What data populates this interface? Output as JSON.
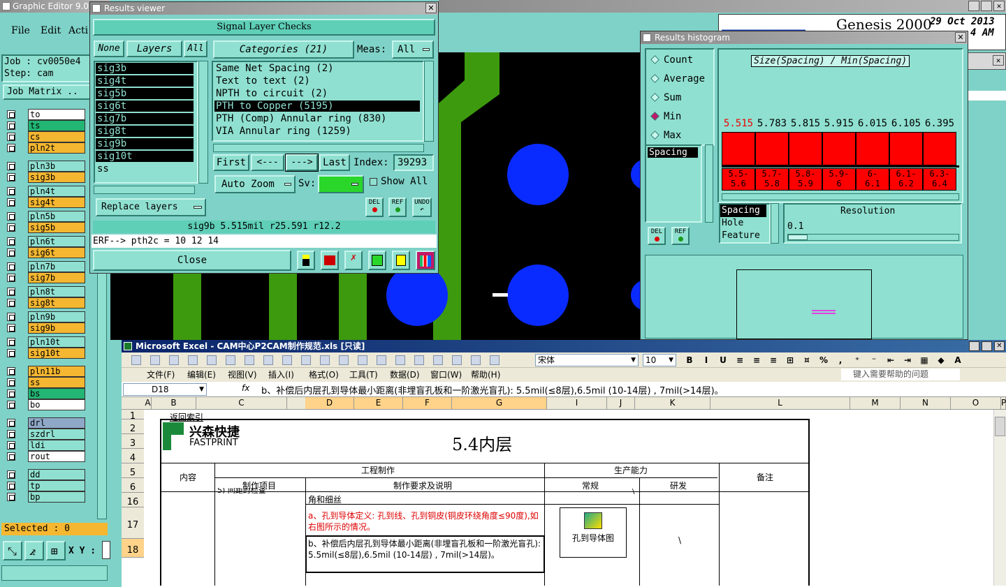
{
  "graphic_editor": {
    "title": "Graphic Editor 9.02",
    "menu": [
      "File",
      "Edit",
      "Acti"
    ],
    "job": "Job : cv0050e4",
    "step": "Step: cam",
    "job_matrix": "Job Matrix ..",
    "selected": "Selected : 0",
    "xy_label": "X Y :"
  },
  "layers_left": [
    {
      "name": "to",
      "color": "#ffffff"
    },
    {
      "name": "ts",
      "color": "#22b573"
    },
    {
      "name": "cs",
      "color": "#f5b731"
    },
    {
      "name": "pln2t",
      "color": "#f5b731"
    },
    {
      "name": "pln3b",
      "color": "#8fe0d0"
    },
    {
      "name": "sig3b",
      "color": "#f5b731"
    },
    {
      "name": "pln4t",
      "color": "#8fe0d0"
    },
    {
      "name": "sig4t",
      "color": "#f5b731"
    },
    {
      "name": "pln5b",
      "color": "#8fe0d0"
    },
    {
      "name": "sig5b",
      "color": "#f5b731"
    },
    {
      "name": "pln6t",
      "color": "#8fe0d0"
    },
    {
      "name": "sig6t",
      "color": "#f5b731"
    },
    {
      "name": "pln7b",
      "color": "#8fe0d0"
    },
    {
      "name": "sig7b",
      "color": "#f5b731"
    },
    {
      "name": "pln8t",
      "color": "#8fe0d0"
    },
    {
      "name": "sig8t",
      "color": "#f5b731"
    },
    {
      "name": "pln9b",
      "color": "#8fe0d0"
    },
    {
      "name": "sig9b",
      "color": "#f5b731"
    },
    {
      "name": "pln10t",
      "color": "#8fe0d0"
    },
    {
      "name": "sig10t",
      "color": "#f5b731"
    },
    {
      "name": "pln11b",
      "color": "#f5b731"
    },
    {
      "name": "ss",
      "color": "#f5b731"
    },
    {
      "name": "bs",
      "color": "#22b573"
    },
    {
      "name": "bo",
      "color": "#ffffff"
    },
    {
      "name": "drl",
      "color": "#8fa8c8"
    },
    {
      "name": "szdrl",
      "color": "#8fe0d0"
    },
    {
      "name": "ldi",
      "color": "#8fe0d0"
    },
    {
      "name": "rout",
      "color": "#ffffff"
    },
    {
      "name": "dd",
      "color": "#8fe0d0"
    },
    {
      "name": "tp",
      "color": "#8fe0d0"
    },
    {
      "name": "bp",
      "color": "#8fe0d0"
    }
  ],
  "results_viewer": {
    "title": "Results viewer",
    "header": "Signal Layer Checks",
    "none": "None",
    "layers": "Layers",
    "all": "All",
    "layer_list": [
      "sig3b",
      "sig4t",
      "sig5b",
      "sig6t",
      "sig7b",
      "sig8t",
      "sig9b",
      "sig10t",
      "ss"
    ],
    "categories_label": "Categories (21)",
    "meas_label": "Meas:",
    "meas_value": "All",
    "categories": [
      "Same Net Spacing (2)",
      "Text to text (2)",
      "NPTH to circuit (2)",
      "PTH to Copper (5195)",
      "PTH (Comp) Annular ring (830)",
      "VIA Annular ring (1259)"
    ],
    "first": "First",
    "prev": "<---",
    "next": "--->",
    "last": "Last",
    "index_label": "Index:",
    "index_value": "39293",
    "auto_zoom": "Auto Zoom",
    "sv_label": "Sv:",
    "show_all": "Show All",
    "replace_layers": "Replace layers",
    "del": "DEL",
    "ref": "REF",
    "undo": "UNDO",
    "status": "sig9b 5.515mil  r25.591  r12.2",
    "erf": "ERF--> pth2c = 10 12 14",
    "close": "Close"
  },
  "genesis": {
    "title": "Genesis 2000",
    "date": "29 Oct 2013",
    "time": "4 AM"
  },
  "histogram": {
    "title": "Results histogram",
    "options": [
      "Count",
      "Average",
      "Sum",
      "Min",
      "Max"
    ],
    "selected_option": "Min",
    "chart_title": "Size(Spacing) / Min(Spacing)",
    "value_labels": [
      "5.515",
      "5.783",
      "5.815",
      "5.915",
      "6.015",
      "6.105",
      "6.395"
    ],
    "range_labels": [
      [
        "5.5-",
        "5.6"
      ],
      [
        "5.7-",
        "5.8"
      ],
      [
        "5.8-",
        "5.9"
      ],
      [
        "5.9-",
        "6"
      ],
      [
        "6-",
        "6.1"
      ],
      [
        "6.1-",
        "6.2"
      ],
      [
        "6.3-",
        "6.4"
      ]
    ],
    "spacing_list": [
      "Spacing"
    ],
    "attr_list": [
      "Spacing",
      "Hole",
      "Feature"
    ],
    "resolution_label": "Resolution",
    "resolution_value": "0.1",
    "del": "DEL",
    "ref": "REF"
  },
  "excel": {
    "title": "Microsoft Excel - CAM中心P2CAM制作规范.xls [只读]",
    "font": "宋体",
    "size": "10",
    "menu": [
      "文件(F)",
      "编辑(E)",
      "视图(V)",
      "插入(I)",
      "格式(O)",
      "工具(T)",
      "数据(D)",
      "窗口(W)",
      "帮助(H)"
    ],
    "help_box": "键入需要帮助的问题",
    "cell_ref": "D18",
    "fx": "fx",
    "formula": "b、补偿后内层孔到导体最小距离(非埋盲孔板和一阶激光盲孔): 5.5mil(≤8层),6.5mil (10-14层) , 7mil(>14层)。",
    "columns": [
      "A",
      "B",
      "C",
      "D",
      "E",
      "F",
      "G",
      "I",
      "J",
      "K",
      "L",
      "M",
      "N",
      "O",
      "P"
    ],
    "rows": [
      "1",
      "2",
      "3",
      "4",
      "5",
      "6",
      "16",
      "17",
      "18"
    ],
    "back_link": "返回索引",
    "logo_cn": "兴森快捷",
    "logo_en": "FASTPRINT",
    "sheet_title": "5.4内层",
    "h_content": "内容",
    "h_eng": "工程制作",
    "h_cap": "生产能力",
    "h_note": "备注",
    "h_item": "制作项目",
    "h_req": "制作要求及说明",
    "h_normal": "常规",
    "h_rd": "研发",
    "r16_c": "5) 间距的检查",
    "r16_d": "角和细丝",
    "r16_j": "\\",
    "r17_d": "a、孔到导体定义: 孔到线、孔到铜皮(铜皮环绕角度≤90度),如右图所示的情况。",
    "r17_i": "孔到导体图",
    "r17_k": "\\",
    "r18_d": "b、补偿后内层孔到导体最小距离(非埋盲孔板和一阶激光盲孔): 5.5mil(≤8层),6.5mil (10-14层) , 7mil(>14层)。"
  }
}
